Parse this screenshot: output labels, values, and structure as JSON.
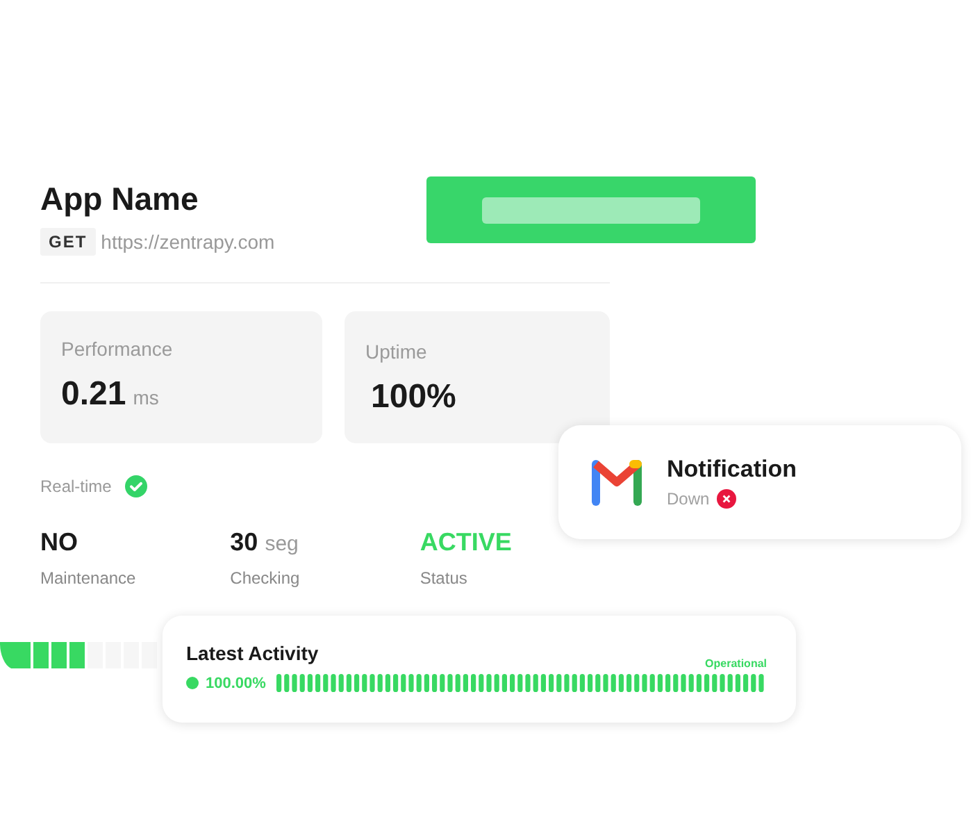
{
  "app": {
    "title": "App Name",
    "method": "GET",
    "url": "https://zentrapy.com"
  },
  "metrics": [
    {
      "label": "Performance",
      "value": "0.21",
      "unit": "ms"
    },
    {
      "label": "Uptime",
      "value": "100%"
    }
  ],
  "realtime": {
    "label": "Real-time",
    "on": true
  },
  "stats": [
    {
      "value": "NO",
      "label": "Maintenance",
      "kind": "plain"
    },
    {
      "value": "30",
      "unit": "seg",
      "label": "Checking",
      "kind": "plain"
    },
    {
      "value": "ACTIVE",
      "label": "Status",
      "kind": "positive"
    }
  ],
  "notification": {
    "title": "Notification",
    "status": "Down",
    "ok": false
  },
  "activity": {
    "title": "Latest Activity",
    "badge": "Operational",
    "percent": "100.00%",
    "ok": true
  }
}
